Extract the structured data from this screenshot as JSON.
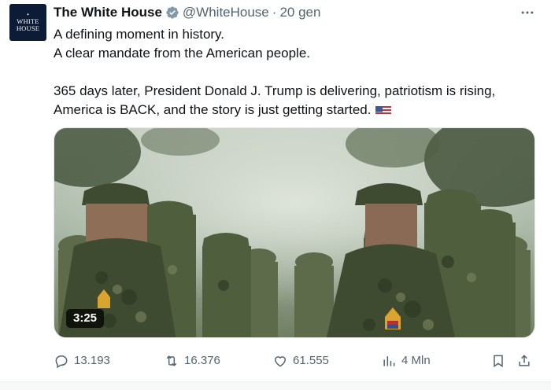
{
  "account": {
    "name": "The White House",
    "handle": "@WhiteHouse",
    "separator": "·",
    "time": "20 gen",
    "avatar_line1": "WHITE",
    "avatar_line2": "HOUSE"
  },
  "tweet": {
    "line1": "A defining moment in history.",
    "line2": "A clear mandate from the American people.",
    "line3": "365 days later, President Donald J. Trump is delivering, patriotism is rising,",
    "line4": "America is BACK, and the story is just getting started."
  },
  "media": {
    "duration": "3:25"
  },
  "actions": {
    "replies": "13.193",
    "reposts": "16.376",
    "likes": "61.555",
    "views": "4 Mln"
  },
  "colors": {
    "text": "#0f1419",
    "secondary": "#536471",
    "verified": "#829aab"
  }
}
